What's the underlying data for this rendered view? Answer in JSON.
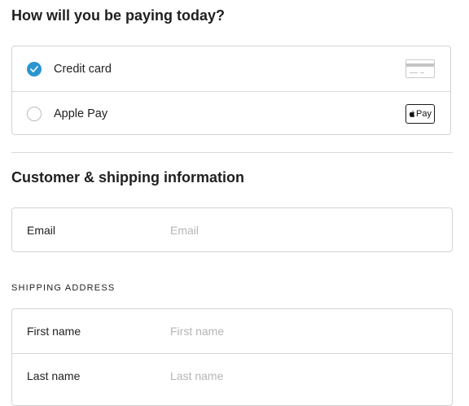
{
  "payment": {
    "heading": "How will you be paying today?",
    "options": [
      {
        "label": "Credit card",
        "selected": true,
        "icon": "credit-card-icon"
      },
      {
        "label": "Apple Pay",
        "selected": false,
        "icon": "apple-pay-icon",
        "badge_text": "Pay"
      }
    ]
  },
  "customer": {
    "heading": "Customer & shipping information",
    "email": {
      "label": "Email",
      "placeholder": "Email",
      "value": ""
    }
  },
  "shipping": {
    "section_label": "SHIPPING ADDRESS",
    "first_name": {
      "label": "First name",
      "placeholder": "First name",
      "value": ""
    },
    "last_name": {
      "label": "Last name",
      "placeholder": "Last name",
      "value": ""
    }
  },
  "colors": {
    "accent": "#2a95cf",
    "border": "#d4d4d4",
    "placeholder": "#b5b5b5"
  }
}
